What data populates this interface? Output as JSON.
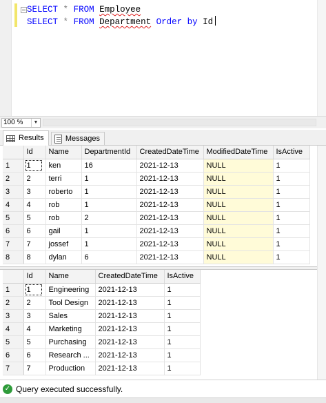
{
  "editor": {
    "lines": [
      {
        "kw1": "SELECT",
        "op": "*",
        "kw2": "FROM",
        "table": "Employee"
      },
      {
        "kw1": "SELECT",
        "op": "*",
        "kw2": "FROM",
        "table": "Department",
        "kw3": "Order by",
        "col": "Id"
      }
    ]
  },
  "zoom": {
    "value": "100 %"
  },
  "tabs": {
    "results": "Results",
    "messages": "Messages"
  },
  "employee_grid": {
    "columns": [
      "",
      "Id",
      "Name",
      "DepartmentId",
      "CreatedDateTime",
      "ModifiedDateTime",
      "IsActive"
    ],
    "rows": [
      [
        "1",
        "1",
        "ken",
        "16",
        "2021-12-13",
        "NULL",
        "1"
      ],
      [
        "2",
        "2",
        "terri",
        "1",
        "2021-12-13",
        "NULL",
        "1"
      ],
      [
        "3",
        "3",
        "roberto",
        "1",
        "2021-12-13",
        "NULL",
        "1"
      ],
      [
        "4",
        "4",
        "rob",
        "1",
        "2021-12-13",
        "NULL",
        "1"
      ],
      [
        "5",
        "5",
        "rob",
        "2",
        "2021-12-13",
        "NULL",
        "1"
      ],
      [
        "6",
        "6",
        "gail",
        "1",
        "2021-12-13",
        "NULL",
        "1"
      ],
      [
        "7",
        "7",
        "jossef",
        "1",
        "2021-12-13",
        "NULL",
        "1"
      ],
      [
        "8",
        "8",
        "dylan",
        "6",
        "2021-12-13",
        "NULL",
        "1"
      ]
    ]
  },
  "department_grid": {
    "columns": [
      "",
      "Id",
      "Name",
      "CreatedDateTime",
      "IsActive"
    ],
    "rows": [
      [
        "1",
        "1",
        "Engineering",
        "2021-12-13",
        "1"
      ],
      [
        "2",
        "2",
        "Tool Design",
        "2021-12-13",
        "1"
      ],
      [
        "3",
        "3",
        "Sales",
        "2021-12-13",
        "1"
      ],
      [
        "4",
        "4",
        "Marketing",
        "2021-12-13",
        "1"
      ],
      [
        "5",
        "5",
        "Purchasing",
        "2021-12-13",
        "1"
      ],
      [
        "6",
        "6",
        "Research ...",
        "2021-12-13",
        "1"
      ],
      [
        "7",
        "7",
        "Production",
        "2021-12-13",
        "1"
      ]
    ]
  },
  "status": {
    "message": "Query executed successfully."
  },
  "colors": {
    "null_cell": "#fffbd8",
    "success": "#2e9b3a",
    "keyword": "#0000ff"
  }
}
